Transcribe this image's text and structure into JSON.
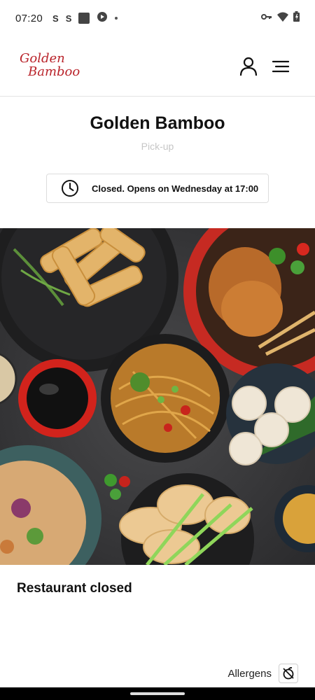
{
  "status_bar": {
    "time": "07:20"
  },
  "header": {
    "logo_line1": "Golden",
    "logo_line2": "Bamboo",
    "logo_color": "#b9232a"
  },
  "page": {
    "title": "Golden Bamboo",
    "subtitle": "Pick-up",
    "hours_notice": "Closed. Opens on Wednesday at 17:00",
    "hero_image": "food-spread-photo",
    "closed_message": "Restaurant closed",
    "allergens_label": "Allergens"
  },
  "icons": {
    "account": "user-icon",
    "menu": "hamburger-menu-icon",
    "clock": "clock-icon",
    "allergens": "allergens-icon"
  }
}
